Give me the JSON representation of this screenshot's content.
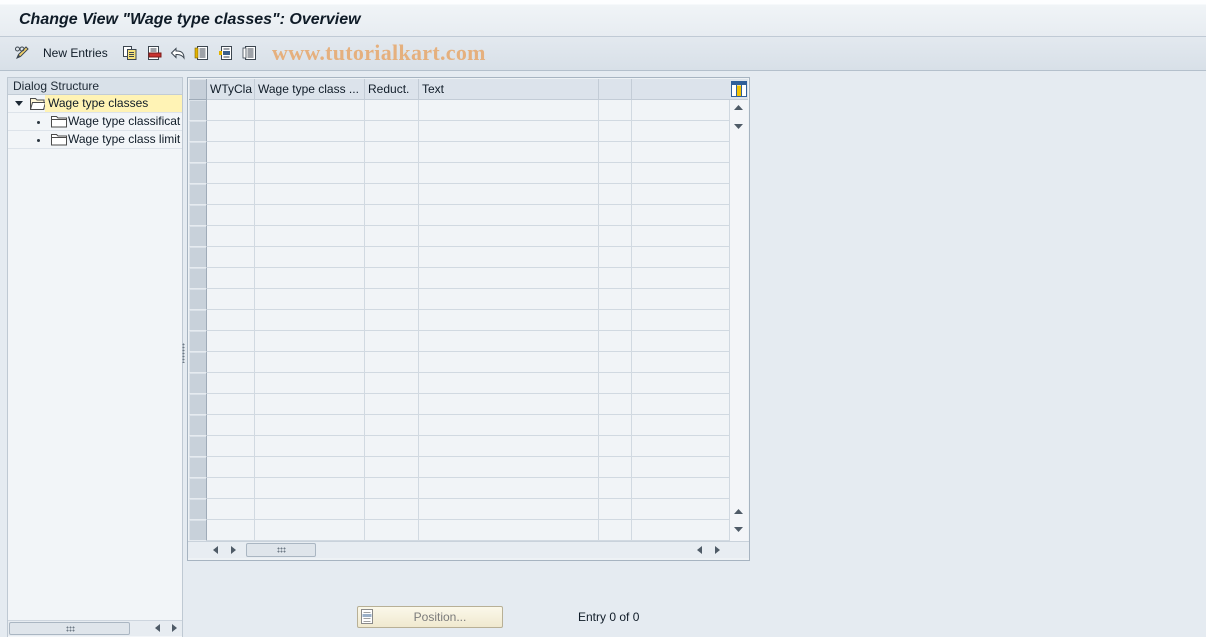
{
  "window": {
    "title": "Change View \"Wage type classes\": Overview"
  },
  "toolbar": {
    "new_entries_label": "New Entries",
    "icons": [
      "display-change-icon",
      "copy-icon",
      "delete-icon",
      "undo-icon",
      "select-all-icon",
      "select-block-icon",
      "deselect-all-icon"
    ],
    "watermark": "www.tutorialkart.com"
  },
  "dialog_structure": {
    "header": "Dialog Structure",
    "items": [
      {
        "label": "Wage type classes",
        "level": 0,
        "expanded": true,
        "selected": true,
        "icon": "folder-open-icon"
      },
      {
        "label": "Wage type classificat",
        "level": 1,
        "expanded": false,
        "selected": false,
        "icon": "folder-icon"
      },
      {
        "label": "Wage type class limit",
        "level": 1,
        "expanded": false,
        "selected": false,
        "icon": "folder-icon"
      }
    ]
  },
  "table": {
    "columns": [
      "WTyCla",
      "Wage type class ...",
      "Reduct.",
      "Text"
    ],
    "rows": []
  },
  "footer": {
    "position_label": "Position...",
    "entry_info": "Entry 0 of 0"
  },
  "colors": {
    "selection_highlight": "#fff3b5",
    "watermark": "#e5b07e"
  }
}
